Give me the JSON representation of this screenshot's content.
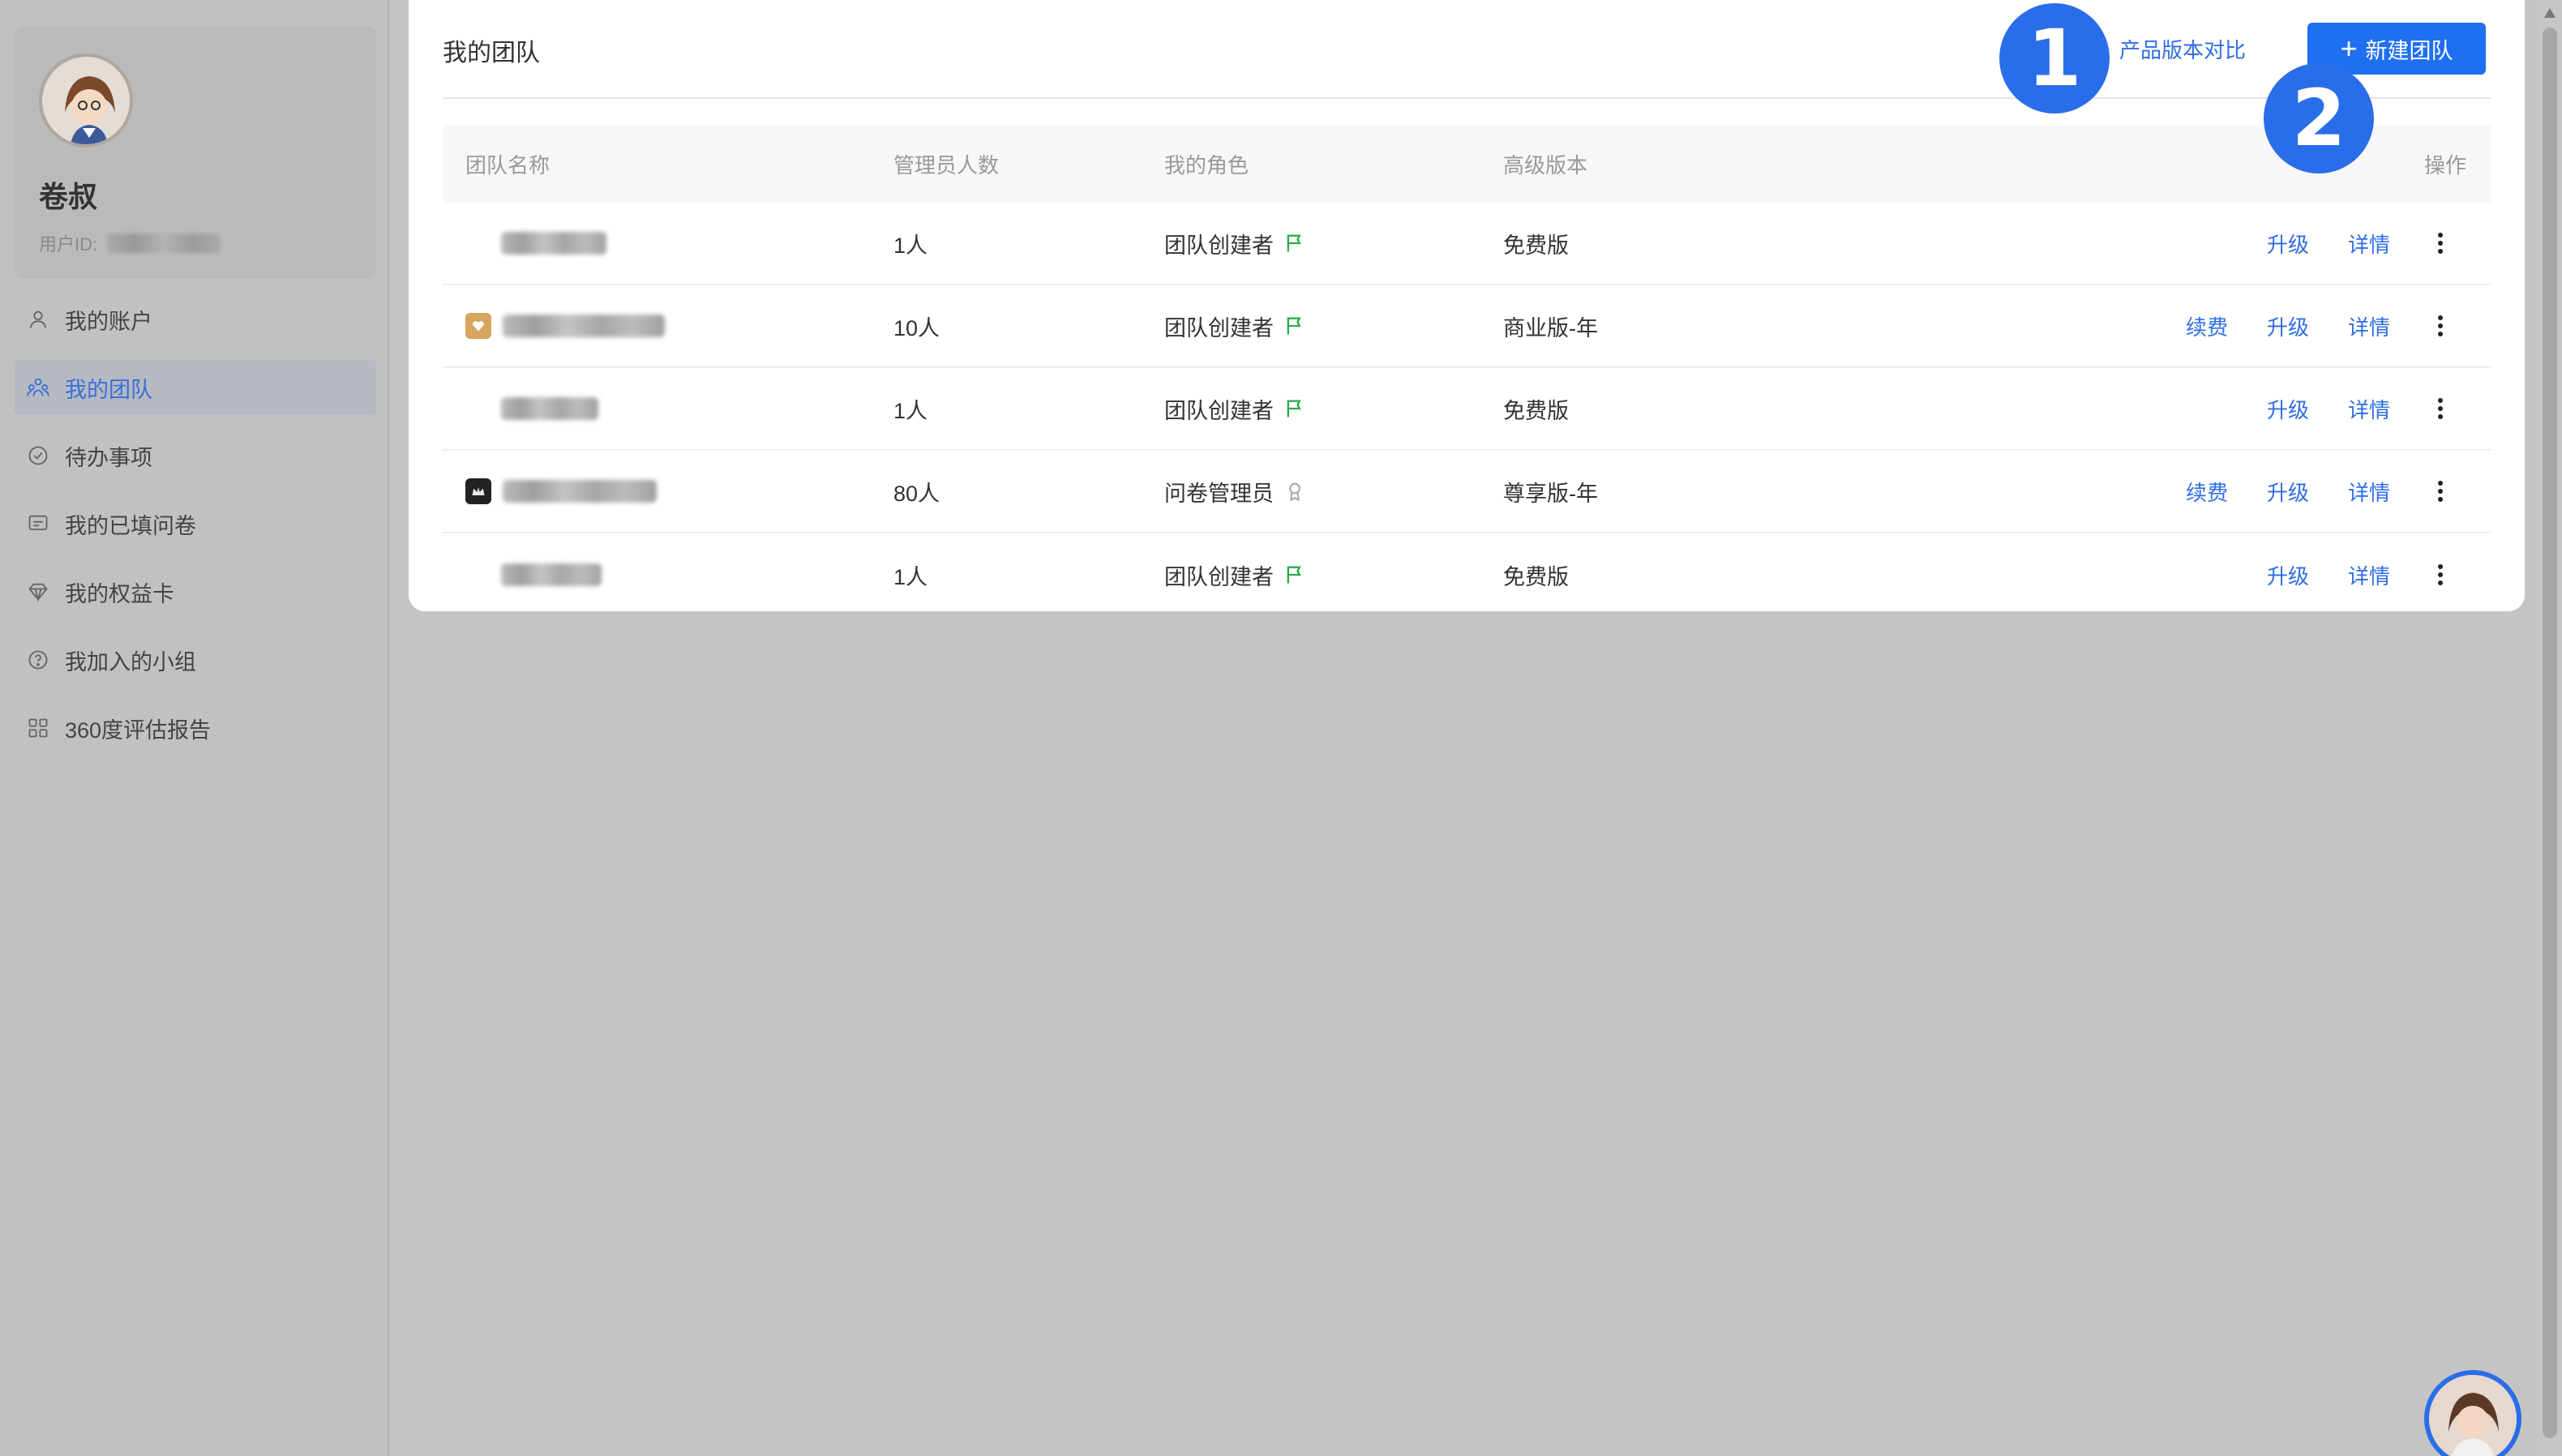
{
  "sidebar": {
    "user_name": "卷叔",
    "user_id_label": "用户ID:",
    "menu": [
      {
        "label": "我的账户",
        "icon": "user-icon",
        "active": false
      },
      {
        "label": "我的团队",
        "icon": "team-icon",
        "active": true
      },
      {
        "label": "待办事项",
        "icon": "check-circle-icon",
        "active": false
      },
      {
        "label": "我的已填问卷",
        "icon": "message-square-icon",
        "active": false
      },
      {
        "label": "我的权益卡",
        "icon": "diamond-icon",
        "active": false
      },
      {
        "label": "我加入的小组",
        "icon": "question-circle-icon",
        "active": false
      },
      {
        "label": "360度评估报告",
        "icon": "grid-icon",
        "active": false
      }
    ]
  },
  "main": {
    "title": "我的团队",
    "compare_link": "产品版本对比",
    "new_team_button": "新建团队",
    "columns": [
      "团队名称",
      "管理员人数",
      "我的角色",
      "高级版本",
      "操作"
    ],
    "rows": [
      {
        "admins": "1人",
        "role": "团队创建者",
        "role_icon": "flag-icon",
        "version": "免费版",
        "renew": "",
        "upgrade": "升级",
        "detail": "详情"
      },
      {
        "admins": "10人",
        "role": "团队创建者",
        "role_icon": "flag-icon",
        "version": "商业版-年",
        "renew": "续费",
        "upgrade": "升级",
        "detail": "详情"
      },
      {
        "admins": "1人",
        "role": "团队创建者",
        "role_icon": "flag-icon",
        "version": "免费版",
        "renew": "",
        "upgrade": "升级",
        "detail": "详情"
      },
      {
        "admins": "80人",
        "role": "问卷管理员",
        "role_icon": "award-icon",
        "version": "尊享版-年",
        "renew": "续费",
        "upgrade": "升级",
        "detail": "详情"
      },
      {
        "admins": "1人",
        "role": "团队创建者",
        "role_icon": "flag-icon",
        "version": "免费版",
        "renew": "",
        "upgrade": "升级",
        "detail": "详情"
      }
    ]
  },
  "annotations": {
    "badge_1": "1",
    "badge_2": "2"
  },
  "colors": {
    "accent": "#1f6ff2",
    "link": "#2f6ee6",
    "flag": "#2eaa4a",
    "overlay": "#c4c4c4"
  }
}
